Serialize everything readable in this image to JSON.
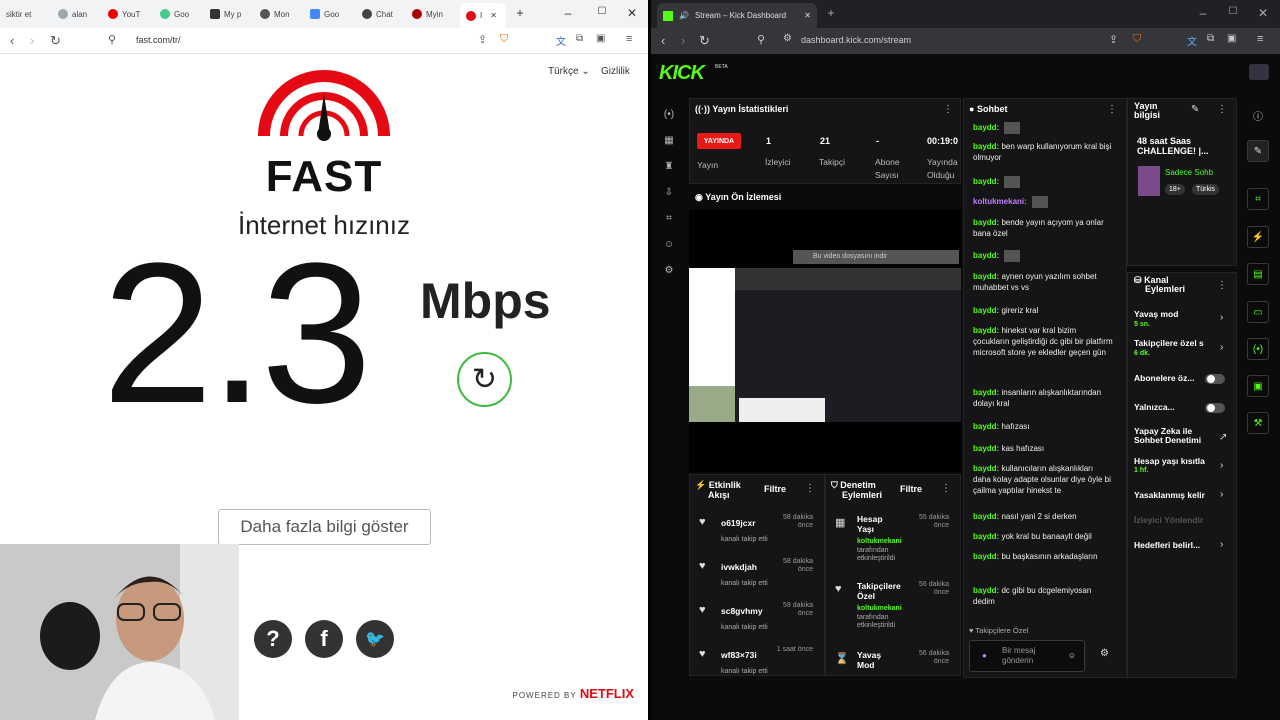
{
  "left_browser": {
    "tabs": [
      "siktir et",
      "alan",
      "YouT",
      "Goo",
      "My p",
      "Mon",
      "Goo",
      "Chat",
      "Myin",
      "I"
    ],
    "url": "fast.com/tr/",
    "language": "Türkçe",
    "privacy": "Gizlilik",
    "logo_text": "FAST",
    "speed_label": "İnternet hızınız",
    "speed_value": "2.3",
    "speed_unit": "Mbps",
    "more_info_button": "Daha fazla bilgi göster",
    "powered_by": "POWERED BY",
    "netflix": "NETFLIX",
    "colors": {
      "brand_red": "#e50914",
      "reload_green": "#3dbb3d"
    }
  },
  "right_browser": {
    "tab_title": "Stream – Kick Dashboard",
    "url": "dashboard.kick.com/stream",
    "logo": "KICK",
    "beta": "BETA",
    "stats": {
      "title": "Yayın İstatistikleri",
      "live": "YAYINDA",
      "live_label": "Yayın",
      "viewers_value": "1",
      "viewers_label": "İzleyici",
      "followers_value": "21",
      "followers_label": "Takipçi",
      "subs_value": "-",
      "subs_label1": "Abone",
      "subs_label2": "Sayısı",
      "time_value": "00:19:0",
      "time_label1": "Yayında",
      "time_label2": "Olduğu"
    },
    "preview": {
      "title": "Yayın Ön İzlemesi",
      "download_banner": "Bu video dosyasını indir"
    },
    "activity": {
      "title1": "Etkinlik",
      "title2": "Akışı",
      "filter": "Filtre",
      "items": [
        {
          "name": "o619jcxr",
          "sub": "kanalı takip etti",
          "time1": "58 dakika",
          "time2": "önce"
        },
        {
          "name": "ivwkdjah",
          "sub": "kanalı takip etti",
          "time1": "58 dakika",
          "time2": "önce"
        },
        {
          "name": "sc8gvhmy",
          "sub": "kanalı takip etti",
          "time1": "59 dakika",
          "time2": "önce"
        },
        {
          "name": "wf83×73i",
          "sub": "kanalı takip etti",
          "time1": "1 saat önce",
          "time2": ""
        }
      ]
    },
    "moderation": {
      "title1": "Denetim",
      "title2": "Eylemleri",
      "filter": "Filtre",
      "items": [
        {
          "name1": "Hesap",
          "name2": "Yaşı",
          "by": "koltukmekani",
          "sub1": "tarafından",
          "sub2": "etkinleştirildi",
          "time1": "55 dakika",
          "time2": "önce"
        },
        {
          "name1": "Takipçilere",
          "name2": "Özel",
          "by": "koltukmekani",
          "sub1": "tarafından",
          "sub2": "etkinleştirildi",
          "time1": "56 dakika",
          "time2": "önce"
        },
        {
          "name1": "Yavaş",
          "name2": "Mod",
          "time1": "56 dakika",
          "time2": "önce"
        }
      ]
    },
    "chat": {
      "title": "Sohbet",
      "messages": [
        {
          "user": "baydd:",
          "text": ""
        },
        {
          "user": "baydd:",
          "text": "ben warp kullanıyorum kral bişi olmuyor"
        },
        {
          "user": "baydd:",
          "text": ""
        },
        {
          "user": "koltukmekani:",
          "text": ""
        },
        {
          "user": "baydd:",
          "text": "bende yayın açıyom ya onlar bana özel"
        },
        {
          "user": "baydd:",
          "text": ""
        },
        {
          "user": "baydd:",
          "text": "aynen oyun yazılım sohbet muhabbet vs vs"
        },
        {
          "user": "baydd:",
          "text": "gireriz kral"
        },
        {
          "user": "baydd:",
          "text": "hinekst var kral bizim çocukların geliştirdiği dc gibi bir platfırm microsoft store ye ekledler geçen gün"
        },
        {
          "user": "baydd:",
          "text": "insanların alışkanlıktarından dolayı kral"
        },
        {
          "user": "baydd:",
          "text": "hafızası"
        },
        {
          "user": "baydd:",
          "text": "kas hafızası"
        },
        {
          "user": "baydd:",
          "text": "kullanıcıların alışkanlıkları daha kolay adapte olsunlar diye öyle bi çailma yaptılar hinekst te"
        },
        {
          "user": "baydd:",
          "text": "nasıl yani 2 si derken"
        },
        {
          "user": "baydd:",
          "text": "yok kral bu banaaylt değil"
        },
        {
          "user": "baydd:",
          "text": "bu başkasının arkadaşların"
        },
        {
          "user": "baydd:",
          "text": "dc gibi bu dcgelemiyosan dedim"
        }
      ],
      "followers_only": "Takipçilere Özel",
      "input_placeholder1": "Bir mesaj",
      "input_placeholder2": "gönderin"
    },
    "stream_info": {
      "title1": "Yayın",
      "title2": "bilgisi",
      "stream_title1": "48 saat Saas",
      "stream_title2": "CHALLENGE! |...",
      "category": "Sadece Sohb",
      "tag1": "18+",
      "tag2": "Türkis"
    },
    "channel_actions": {
      "title1": "Kanal",
      "title2": "Eylemleri",
      "slow_mode": "Yavaş mod",
      "slow_value": "5 sn.",
      "followers_only": "Takipçilere özel s",
      "followers_value": "6 dk.",
      "subs_only": "Abonelere öz...",
      "only": "Yalnızca...",
      "ai1": "Yapay Zeka ile",
      "ai2": "Sohbet Denetimi",
      "age": "Hesap yaşı kısıtla",
      "age_value": "1 hf.",
      "banned": "Yasaklanmış kelir",
      "redirect": "İzleyici Yönlendir",
      "goals": "Hedefleri belirl..."
    },
    "colors": {
      "accent": "#53fc18",
      "live": "#e91916"
    }
  }
}
